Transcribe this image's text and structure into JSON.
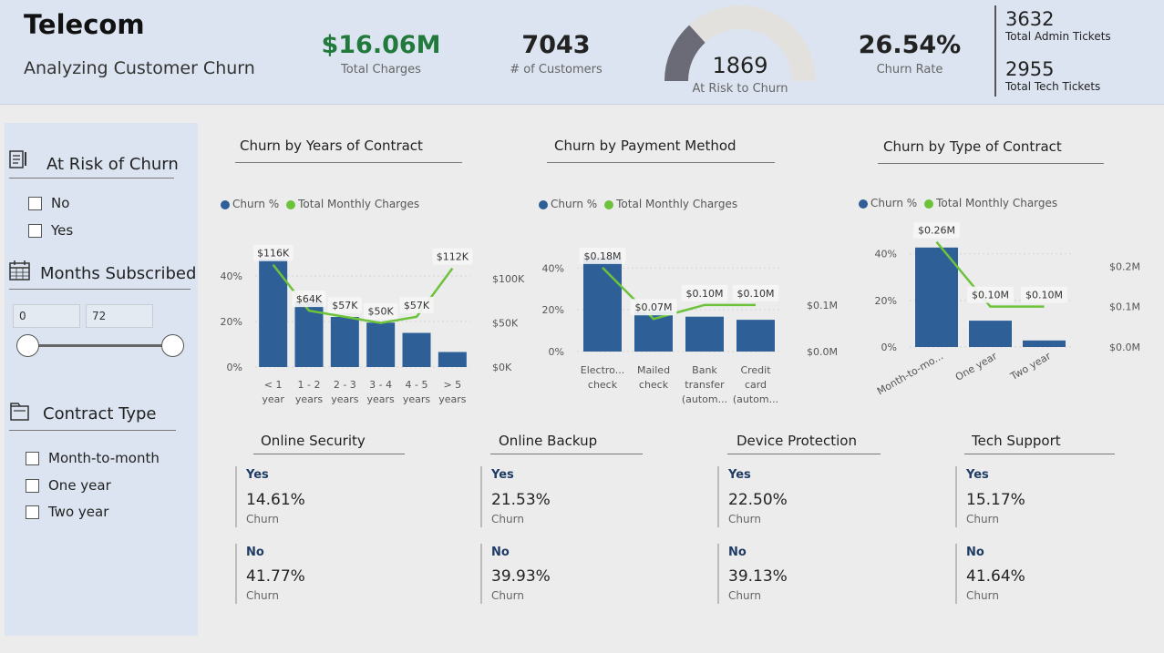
{
  "header": {
    "title": "Telecom",
    "subtitle": "Analyzing Customer Churn",
    "total_charges": {
      "value": "$16.06M",
      "label": "Total Charges",
      "color": "#217a3c"
    },
    "customers": {
      "value": "7043",
      "label": "# of Customers"
    },
    "at_risk": {
      "value": "1869",
      "label": "At Risk to Churn",
      "gauge_fraction": 0.265
    },
    "churn_rate": {
      "value": "26.54%",
      "label": "Churn Rate"
    },
    "admin_tickets": {
      "value": "3632",
      "label": "Total Admin Tickets"
    },
    "tech_tickets": {
      "value": "2955",
      "label": "Total Tech Tickets"
    }
  },
  "slicers": {
    "at_risk": {
      "title": "At Risk of Churn",
      "icon": "notepad-icon",
      "options": [
        "No",
        "Yes"
      ]
    },
    "months": {
      "title": "Months Subscribed",
      "icon": "calendar-icon",
      "min": "0",
      "max": "72"
    },
    "contract": {
      "title": "Contract Type",
      "icon": "folder-icon",
      "options": [
        "Month-to-month",
        "One year",
        "Two year"
      ]
    }
  },
  "legend": {
    "churn": "Churn %",
    "charges": "Total Monthly Charges",
    "churn_color": "#2f5f97",
    "charges_color": "#6cc23a"
  },
  "chart_data": [
    {
      "type": "bar",
      "title": "Churn by Years of Contract",
      "categories": [
        [
          "< 1",
          "year"
        ],
        [
          "1 - 2",
          "years"
        ],
        [
          "2 - 3",
          "years"
        ],
        [
          "3 - 4",
          "years"
        ],
        [
          "4 - 5",
          "years"
        ],
        [
          "> 5",
          "years"
        ]
      ],
      "series": [
        {
          "name": "Churn %",
          "values": [
            47.4,
            28.7,
            22.0,
            19.5,
            15.0,
            6.6
          ]
        },
        {
          "name": "Total Monthly Charges",
          "type": "line",
          "values": [
            116,
            64,
            57,
            50,
            57,
            112
          ],
          "labels": [
            "$116K",
            "$64K",
            "$57K",
            "$50K",
            "$57K",
            "$112K"
          ]
        }
      ],
      "y_ticks": [
        "0%",
        "20%",
        "40%"
      ],
      "y2_ticks": [
        "$0K",
        "$50K",
        "$100K"
      ]
    },
    {
      "type": "bar",
      "title": "Churn by Payment Method",
      "categories": [
        [
          "Electro...",
          "check"
        ],
        [
          "Mailed",
          "check"
        ],
        [
          "Bank",
          "transfer",
          "(autom..."
        ],
        [
          "Credit",
          "card",
          "(autom..."
        ]
      ],
      "series": [
        {
          "name": "Churn %",
          "values": [
            45.3,
            19.1,
            16.7,
            15.2
          ]
        },
        {
          "name": "Total Monthly Charges",
          "type": "line",
          "values": [
            0.18,
            0.07,
            0.1,
            0.1
          ],
          "labels": [
            "$0.18M",
            "$0.07M",
            "$0.10M",
            "$0.10M"
          ]
        }
      ],
      "y_ticks": [
        "0%",
        "20%",
        "40%"
      ],
      "y2_ticks": [
        "$0.0M",
        "$0.1M"
      ]
    },
    {
      "type": "bar",
      "title": "Churn by Type of Contract",
      "categories": [
        [
          "Month-to-mo..."
        ],
        [
          "One year"
        ],
        [
          "Two year"
        ]
      ],
      "series": [
        {
          "name": "Churn %",
          "values": [
            42.7,
            11.3,
            2.8
          ]
        },
        {
          "name": "Total Monthly Charges",
          "type": "line",
          "values": [
            0.26,
            0.1,
            0.1
          ],
          "labels": [
            "$0.26M",
            "$0.10M",
            "$0.10M"
          ]
        }
      ],
      "y_ticks": [
        "0%",
        "20%",
        "40%"
      ],
      "y2_ticks": [
        "$0.0M",
        "$0.1M",
        "$0.2M"
      ]
    }
  ],
  "cards": [
    {
      "title": "Online Security",
      "yes_label": "Yes",
      "yes_value": "14.61%",
      "no_label": "No",
      "no_value": "41.77%",
      "sub": "Churn"
    },
    {
      "title": "Online Backup",
      "yes_label": "Yes",
      "yes_value": "21.53%",
      "no_label": "No",
      "no_value": "39.93%",
      "sub": "Churn"
    },
    {
      "title": "Device Protection",
      "yes_label": "Yes",
      "yes_value": "22.50%",
      "no_label": "No",
      "no_value": "39.13%",
      "sub": "Churn"
    },
    {
      "title": "Tech Support",
      "yes_label": "Yes",
      "yes_value": "15.17%",
      "no_label": "No",
      "no_value": "41.64%",
      "sub": "Churn"
    }
  ]
}
